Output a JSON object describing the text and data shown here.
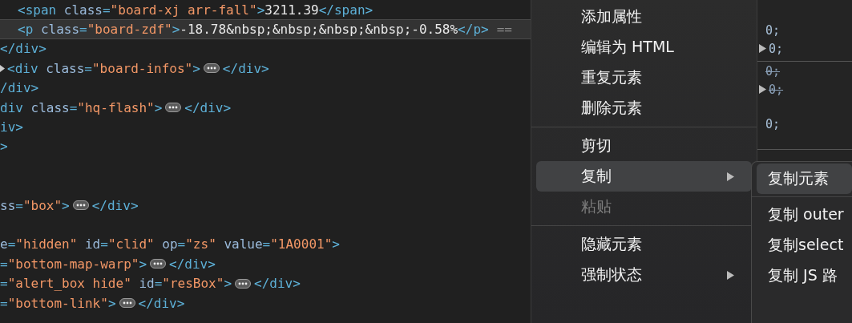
{
  "elements_tree": {
    "nodes": [
      {
        "children": [
          {
            "selected": false,
            "toggle": false,
            "tokens": [
              {
                "kind": "tag",
                "text": "<span "
              },
              {
                "kind": "attr",
                "text": "class"
              },
              {
                "kind": "tag",
                "text": "="
              },
              {
                "kind": "value",
                "text": "\"board-xj arr-fall\""
              },
              {
                "kind": "tag",
                "text": ">"
              },
              {
                "kind": "text",
                "text": "3211.39"
              },
              {
                "kind": "tag",
                "text": "</span>"
              }
            ]
          },
          {
            "selected": true,
            "toggle": false,
            "tokens": [
              {
                "kind": "tag",
                "text": "<p "
              },
              {
                "kind": "attr",
                "text": "class"
              },
              {
                "kind": "tag",
                "text": "="
              },
              {
                "kind": "value",
                "text": "\"board-zdf\""
              },
              {
                "kind": "tag",
                "text": ">"
              },
              {
                "kind": "text",
                "text": "-18.78&nbsp;&nbsp;&nbsp;&nbsp;-0.58%"
              },
              {
                "kind": "tag",
                "text": "</p>"
              },
              {
                "kind": "marker",
                "text": "=="
              }
            ]
          }
        ]
      },
      {
        "selected": false,
        "toggle": false,
        "tokens": [
          {
            "kind": "tag",
            "text": "</div>"
          }
        ]
      },
      {
        "selected": false,
        "toggle": true,
        "tokens": [
          {
            "kind": "tag",
            "text": "<div "
          },
          {
            "kind": "attr",
            "text": "class"
          },
          {
            "kind": "tag",
            "text": "="
          },
          {
            "kind": "value",
            "text": "\"board-infos\""
          },
          {
            "kind": "tag",
            "text": ">"
          },
          {
            "kind": "ellipsis"
          },
          {
            "kind": "tag",
            "text": "</div>"
          }
        ]
      },
      {
        "selected": false,
        "toggle": false,
        "tokens": [
          {
            "kind": "tag",
            "text": "/div>"
          }
        ]
      },
      {
        "selected": false,
        "toggle": false,
        "tokens": [
          {
            "kind": "tag",
            "text": "div "
          },
          {
            "kind": "attr",
            "text": "class"
          },
          {
            "kind": "tag",
            "text": "="
          },
          {
            "kind": "value",
            "text": "\"hq-flash\""
          },
          {
            "kind": "tag",
            "text": ">"
          },
          {
            "kind": "ellipsis"
          },
          {
            "kind": "tag",
            "text": "</div>"
          }
        ]
      },
      {
        "selected": false,
        "toggle": false,
        "tokens": [
          {
            "kind": "tag",
            "text": "iv>"
          }
        ]
      },
      {
        "selected": false,
        "toggle": false,
        "tokens": [
          {
            "kind": "tag",
            "text": ">"
          }
        ]
      },
      {
        "kind": "blank"
      },
      {
        "kind": "blank"
      },
      {
        "selected": false,
        "toggle": false,
        "tokens": [
          {
            "kind": "attr",
            "text": "ss"
          },
          {
            "kind": "tag",
            "text": "="
          },
          {
            "kind": "value",
            "text": "\"box\""
          },
          {
            "kind": "tag",
            "text": ">"
          },
          {
            "kind": "ellipsis"
          },
          {
            "kind": "tag",
            "text": "</div>"
          }
        ]
      },
      {
        "kind": "blank"
      },
      {
        "selected": false,
        "toggle": false,
        "tokens": [
          {
            "kind": "attr",
            "text": "e"
          },
          {
            "kind": "tag",
            "text": "="
          },
          {
            "kind": "value",
            "text": "\"hidden\" "
          },
          {
            "kind": "attr",
            "text": "id"
          },
          {
            "kind": "tag",
            "text": "="
          },
          {
            "kind": "value",
            "text": "\"clid\" "
          },
          {
            "kind": "attr",
            "text": "op"
          },
          {
            "kind": "tag",
            "text": "="
          },
          {
            "kind": "value",
            "text": "\"zs\" "
          },
          {
            "kind": "attr",
            "text": "value"
          },
          {
            "kind": "tag",
            "text": "="
          },
          {
            "kind": "value",
            "text": "\"1A0001\""
          },
          {
            "kind": "tag",
            "text": ">"
          }
        ]
      },
      {
        "selected": false,
        "toggle": false,
        "tokens": [
          {
            "kind": "tag",
            "text": "="
          },
          {
            "kind": "value",
            "text": "\"bottom-map-warp\""
          },
          {
            "kind": "tag",
            "text": ">"
          },
          {
            "kind": "ellipsis"
          },
          {
            "kind": "tag",
            "text": "</div>"
          }
        ]
      },
      {
        "selected": false,
        "toggle": false,
        "tokens": [
          {
            "kind": "tag",
            "text": "="
          },
          {
            "kind": "value",
            "text": "\"alert_box hide\" "
          },
          {
            "kind": "attr",
            "text": "id"
          },
          {
            "kind": "tag",
            "text": "="
          },
          {
            "kind": "value",
            "text": "\"resBox\""
          },
          {
            "kind": "tag",
            "text": ">"
          },
          {
            "kind": "ellipsis"
          },
          {
            "kind": "tag",
            "text": "</div>"
          }
        ]
      },
      {
        "selected": false,
        "toggle": false,
        "tokens": [
          {
            "kind": "tag",
            "text": "="
          },
          {
            "kind": "value",
            "text": "\"bottom-link\""
          },
          {
            "kind": "tag",
            "text": ">"
          },
          {
            "kind": "ellipsis"
          },
          {
            "kind": "tag",
            "text": "</div>"
          }
        ]
      }
    ]
  },
  "styles_pane": {
    "groups": [
      {
        "entries": [
          {
            "value": "0;",
            "toggle": false,
            "struck": false
          },
          {
            "value": "0;",
            "toggle": true,
            "struck": false
          }
        ]
      },
      {
        "entries": [
          {
            "value": "0;",
            "toggle": false,
            "struck": true
          },
          {
            "value": "0;",
            "toggle": true,
            "struck": true
          }
        ]
      },
      {
        "entries": [
          {
            "value": "0;",
            "toggle": false,
            "struck": false
          }
        ]
      }
    ]
  },
  "context_menu": {
    "items": [
      {
        "kind": "item",
        "label": "添加属性",
        "selected": false,
        "disabled": false,
        "submenu": false
      },
      {
        "kind": "item",
        "label": "编辑为 HTML",
        "selected": false,
        "disabled": false,
        "submenu": false
      },
      {
        "kind": "item",
        "label": "重复元素",
        "selected": false,
        "disabled": false,
        "submenu": false
      },
      {
        "kind": "item",
        "label": "删除元素",
        "selected": false,
        "disabled": false,
        "submenu": false
      },
      {
        "kind": "separator"
      },
      {
        "kind": "item",
        "label": "剪切",
        "selected": false,
        "disabled": false,
        "submenu": false
      },
      {
        "kind": "item",
        "label": "复制",
        "selected": true,
        "disabled": false,
        "submenu": true
      },
      {
        "kind": "item",
        "label": "粘贴",
        "selected": false,
        "disabled": true,
        "submenu": false
      },
      {
        "kind": "separator"
      },
      {
        "kind": "item",
        "label": "隐藏元素",
        "selected": false,
        "disabled": false,
        "submenu": false
      },
      {
        "kind": "item",
        "label": "强制状态",
        "selected": false,
        "disabled": false,
        "submenu": true
      }
    ]
  },
  "submenu": {
    "items": [
      {
        "kind": "item",
        "label": "复制元素",
        "selected": true
      },
      {
        "kind": "separator"
      },
      {
        "kind": "item",
        "label": "复制 outer",
        "selected": false
      },
      {
        "kind": "item",
        "label": "复制select",
        "selected": false
      },
      {
        "kind": "item",
        "label": "复制 JS 路",
        "selected": false
      }
    ]
  }
}
